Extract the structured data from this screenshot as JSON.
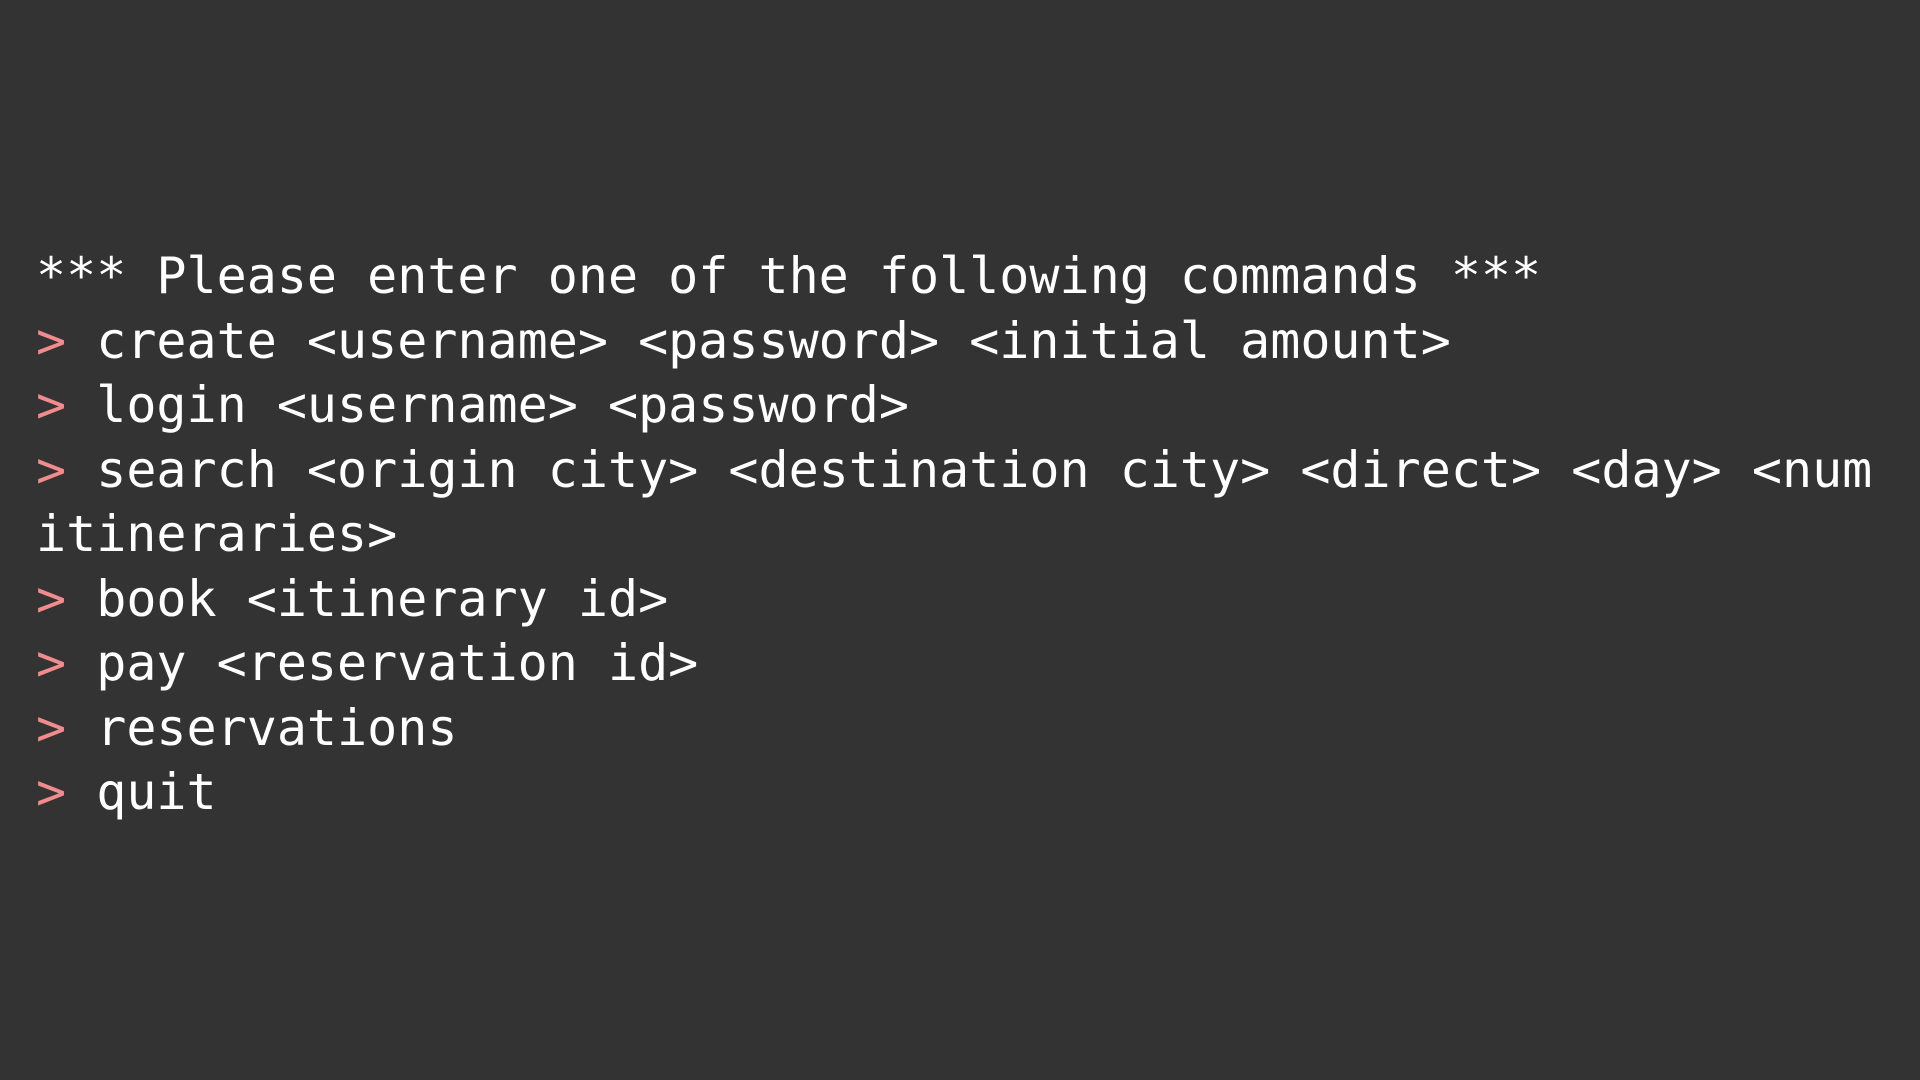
{
  "colors": {
    "background": "#333333",
    "text": "#ffffff",
    "prompt": "#f28b8b"
  },
  "terminal": {
    "header": "*** Please enter one of the following commands ***",
    "prompt_symbol": ">",
    "commands": [
      "create <username> <password> <initial amount>",
      "login <username> <password>",
      "search <origin city> <destination city> <direct> <day> <num itineraries>",
      "book <itinerary id>",
      "pay <reservation id>",
      "reservations",
      "quit"
    ]
  }
}
